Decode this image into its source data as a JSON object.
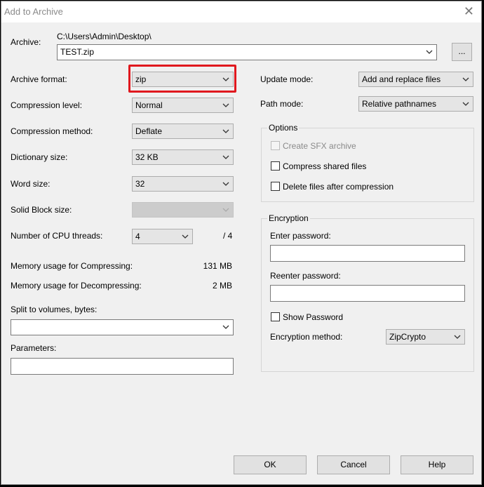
{
  "window": {
    "title": "Add to Archive",
    "close_icon": "close-icon"
  },
  "archive": {
    "label": "Archive:",
    "path": "C:\\Users\\Admin\\Desktop\\",
    "value": "TEST.zip",
    "browse_label": "..."
  },
  "left": {
    "archive_format": {
      "label": "Archive format:",
      "value": "zip"
    },
    "compression_level": {
      "label": "Compression level:",
      "value": "Normal"
    },
    "compression_method": {
      "label": "Compression method:",
      "value": "Deflate"
    },
    "dictionary_size": {
      "label": "Dictionary size:",
      "value": "32 KB"
    },
    "word_size": {
      "label": "Word size:",
      "value": "32"
    },
    "solid_block": {
      "label": "Solid Block size:",
      "value": ""
    },
    "cpu_threads": {
      "label": "Number of CPU threads:",
      "value": "4",
      "max": "/ 4"
    },
    "mem_compress": {
      "label": "Memory usage for Compressing:",
      "value": "131 MB"
    },
    "mem_decompress": {
      "label": "Memory usage for Decompressing:",
      "value": "2 MB"
    },
    "split": {
      "label": "Split to volumes, bytes:",
      "value": ""
    },
    "parameters": {
      "label": "Parameters:",
      "value": ""
    }
  },
  "right": {
    "update_mode": {
      "label": "Update mode:",
      "value": "Add and replace files"
    },
    "path_mode": {
      "label": "Path mode:",
      "value": "Relative pathnames"
    },
    "options": {
      "title": "Options",
      "sfx": "Create SFX archive",
      "shared": "Compress shared files",
      "delete": "Delete files after compression"
    },
    "encryption": {
      "title": "Encryption",
      "enter_label": "Enter password:",
      "reenter_label": "Reenter password:",
      "show_password": "Show Password",
      "method_label": "Encryption method:",
      "method_value": "ZipCrypto"
    }
  },
  "buttons": {
    "ok": "OK",
    "cancel": "Cancel",
    "help": "Help"
  },
  "colors": {
    "highlight": "#e0181e",
    "background": "#f0f0f0"
  }
}
